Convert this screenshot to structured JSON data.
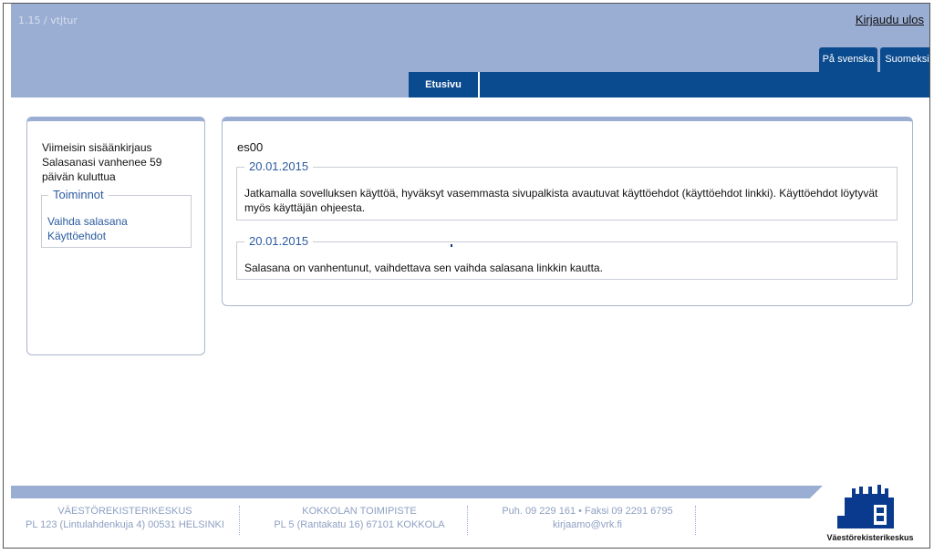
{
  "header": {
    "version": "1.15 / vtjtur",
    "logout_label": "Kirjaudu ulos",
    "languages": [
      "På svenska",
      "Suomeksi"
    ],
    "nav_tab": "Etusivu"
  },
  "sidebar": {
    "last_login_line1": "Viimeisin sisäänkirjaus",
    "password_expiry": "Salasanasi vanhenee 59 päivän kuluttua",
    "actions_title": "Toiminnot",
    "links": [
      "Vaihda salasana",
      "Käyttöehdot"
    ]
  },
  "main": {
    "user": "es00",
    "messages": [
      {
        "date": "20.01.2015",
        "text": "Jatkamalla sovelluksen käyttöä, hyväksyt vasemmasta sivupalkista avautuvat käyttöehdot (käyttöehdot linkki). Käyttöehdot löytyvät myös käyttäjän ohjeesta."
      },
      {
        "date": "20.01.2015",
        "text": "Salasana on vanhentunut, vaihdettava sen vaihda salasana linkkin kautta."
      }
    ]
  },
  "footer": {
    "col1": {
      "line1": "VÄESTÖREKISTERIKESKUS",
      "line2": "PL 123 (Lintulahdenkuja 4) 00531 HELSINKI"
    },
    "col2": {
      "line1": "KOKKOLAN TOIMIPISTE",
      "line2": "PL 5 (Rantakatu 16) 67101 KOKKOLA"
    },
    "col3": {
      "line1": "Puh. 09 229 161 • Faksi 09 2291 6795",
      "line2": "kirjaamo@vrk.fi"
    },
    "logo_text": "Väestörekisterikeskus"
  },
  "colors": {
    "header_bg": "#9aaed3",
    "nav_blue": "#0a4a8e",
    "link_blue": "#2b5aa0"
  },
  "icons": {
    "logo": "vrk-castle-logo"
  }
}
